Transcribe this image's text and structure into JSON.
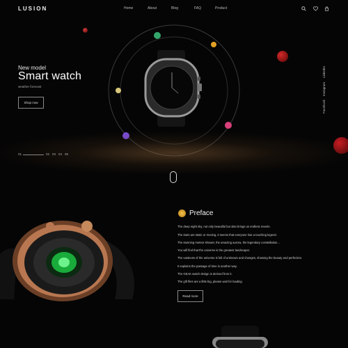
{
  "header": {
    "logo": "LUSION",
    "nav": [
      "Home",
      "About",
      "Blog",
      "FAQ",
      "Product"
    ],
    "icons": [
      "search-icon",
      "heart-icon",
      "cart-icon"
    ]
  },
  "hero": {
    "subtitle": "New model",
    "title": "Smart watch",
    "tagline": "weather forecast",
    "button": "Shop now"
  },
  "social": [
    "LinkedIn",
    "Instagram",
    "Facebook"
  ],
  "pager": {
    "current": "01",
    "pages": [
      "02",
      "03",
      "04",
      "05"
    ]
  },
  "preface": {
    "title": "Preface",
    "lines": [
      "The deep night sky, not only beautiful but also brings us endless reverie.",
      "The stars are static or moving, it seems that everyone has a touching legend.",
      "The stunning meteor shower, the amazing aurora, the legendary constellation...",
      "You will find that the universe is the greatest landscaper.",
      "The vastness of the universe is full of unknown and changes, showing the beauty and perfection.",
      "It explains the passage of time in another way.",
      "The GEAK watch design is derived from it.",
      "The gift files are a little big, please wait for loading."
    ],
    "button": "Read more"
  },
  "colors": {
    "background": "#050505",
    "glow": "#8a5f32",
    "accent_planet": "#b8161c"
  }
}
